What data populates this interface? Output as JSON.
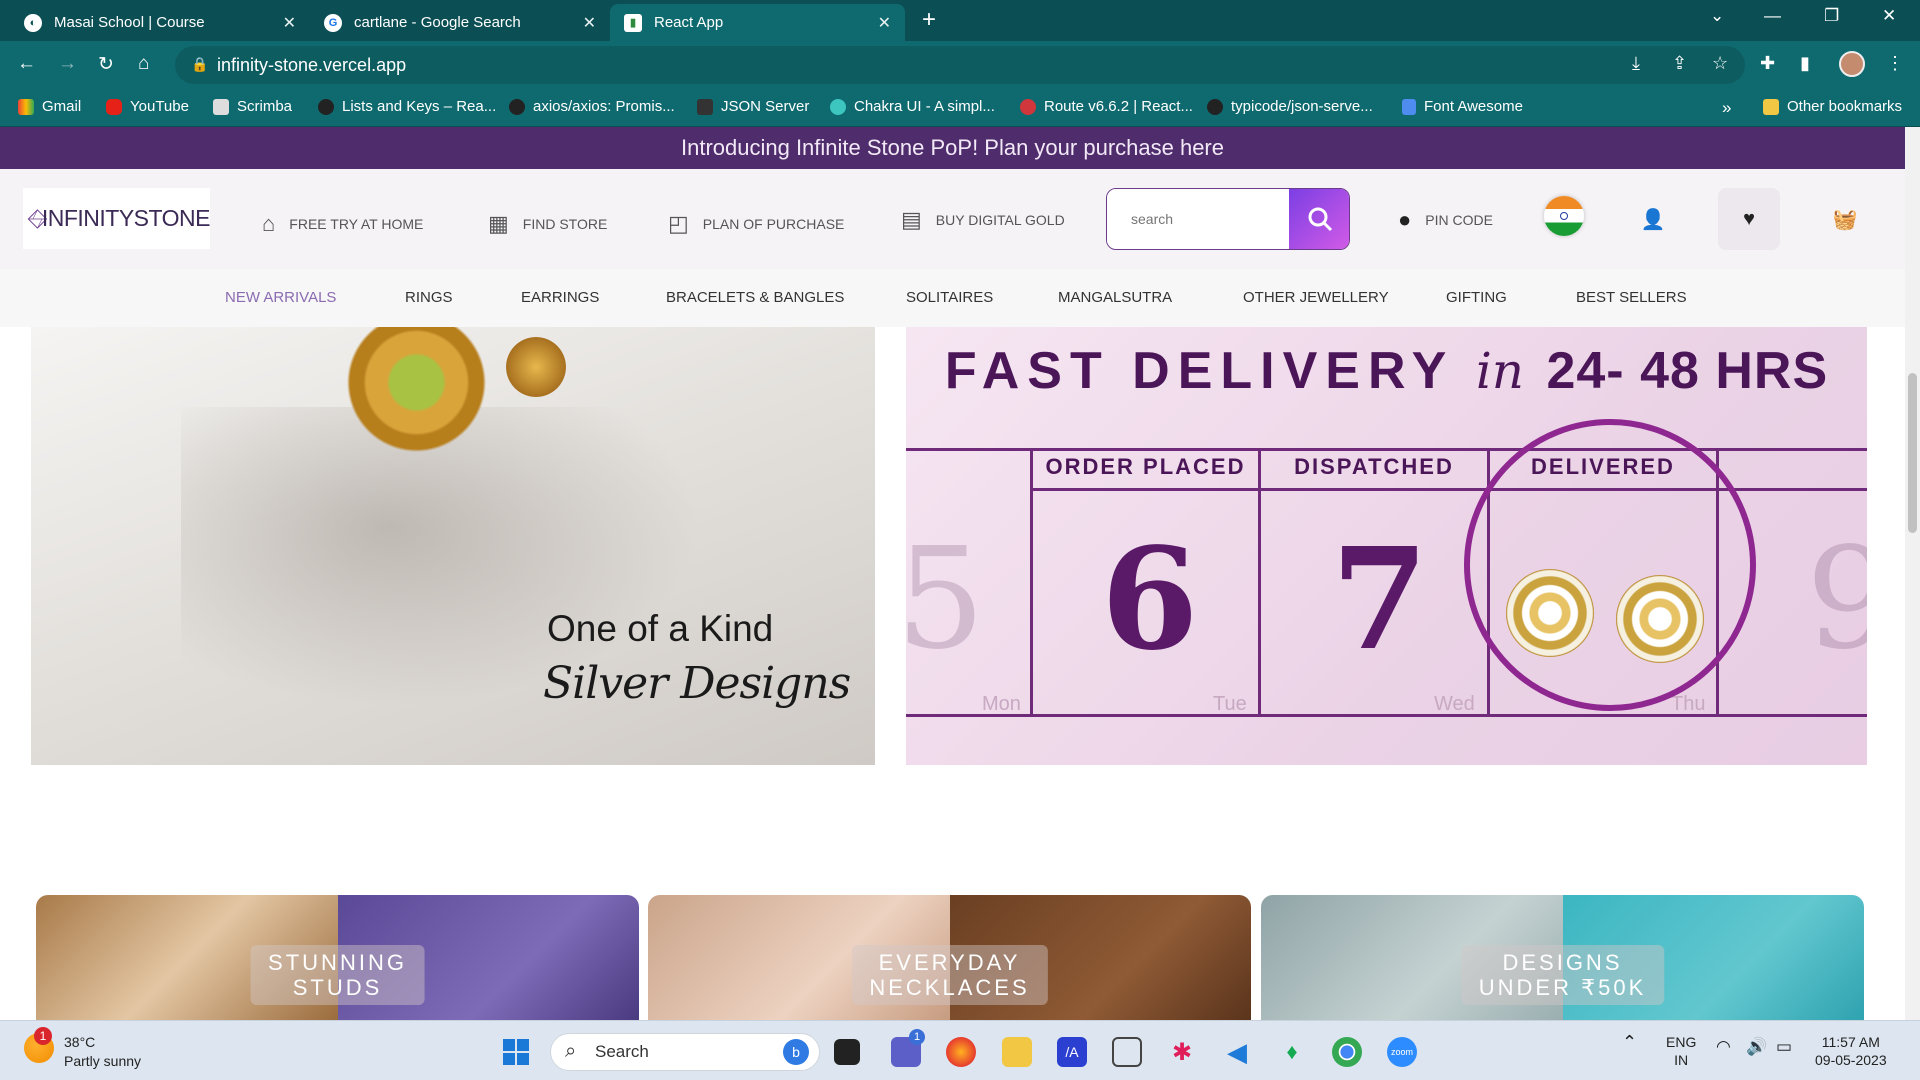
{
  "browser": {
    "tabs": [
      {
        "title": "Masai School | Course",
        "active": false
      },
      {
        "title": "cartlane - Google Search",
        "active": false
      },
      {
        "title": "React App",
        "active": true
      }
    ],
    "url": "infinity-stone.vercel.app",
    "bookmarks": [
      "Gmail",
      "YouTube",
      "Scrimba",
      "Lists and Keys – Rea...",
      "axios/axios: Promis...",
      "JSON Server",
      "Chakra UI - A simpl...",
      "Route v6.6.2 | React...",
      "typicode/json-serve...",
      "Font Awesome"
    ],
    "other_bookmarks": "Other bookmarks",
    "overflow": "»"
  },
  "site": {
    "promo": "Introducing Infinite Stone PoP! Plan your purchase here",
    "logo": "INFINITYSTONE",
    "header_nav": [
      {
        "label": "FREE TRY AT HOME",
        "icon": "home-icon"
      },
      {
        "label": "FIND STORE",
        "icon": "store-icon"
      },
      {
        "label": "PLAN OF PURCHASE",
        "icon": "bag-icon"
      },
      {
        "label": "BUY DIGITAL GOLD",
        "icon": "gold-icon"
      }
    ],
    "search_placeholder": "search",
    "pin_code": "PIN CODE",
    "menu": [
      "NEW ARRIVALS",
      "RINGS",
      "EARRINGS",
      "BRACELETS & BANGLES",
      "SOLITAIRES",
      "MANGALSUTRA",
      "OTHER JEWELLERY",
      "GIFTING",
      "BEST SELLERS"
    ],
    "active_menu": "NEW ARRIVALS",
    "accent_color": "#4f2c6c"
  },
  "banner_left": {
    "line1": "One of a Kind",
    "line2": "Silver Designs"
  },
  "banner_right": {
    "headline_a": "FAST DELIVERY",
    "headline_b": "in",
    "headline_c": "24- 48 HRS",
    "columns": [
      "ORDER PLACED",
      "DISPATCHED",
      "DELIVERED"
    ],
    "dates": [
      "5",
      "6",
      "7",
      "9"
    ],
    "days": [
      "Mon",
      "Tue",
      "Wed",
      "Thu"
    ]
  },
  "categories": [
    {
      "line1": "STUNNING",
      "line2": "STUDS"
    },
    {
      "line1": "EVERYDAY",
      "line2": "NECKLACES"
    },
    {
      "line1": "DESIGNS",
      "line2": "UNDER ₹50K"
    }
  ],
  "taskbar": {
    "temp": "38°C",
    "weather": "Partly sunny",
    "weather_badge": "1",
    "search": "Search",
    "lang1": "ENG",
    "lang2": "IN",
    "time": "11:57 AM",
    "date": "09-05-2023",
    "teams_badge": "1"
  }
}
